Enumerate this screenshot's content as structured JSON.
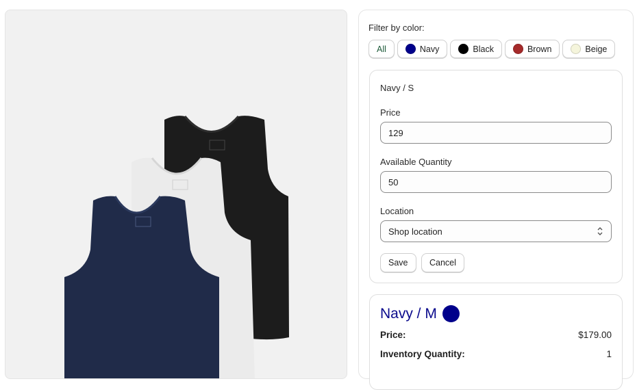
{
  "product_image": {
    "alt": "Tank tops in navy, white and black"
  },
  "filter": {
    "label": "Filter by color:",
    "chips": [
      {
        "label": "All",
        "color": null
      },
      {
        "label": "Navy",
        "color": "#00008B"
      },
      {
        "label": "Black",
        "color": "#000000"
      },
      {
        "label": "Brown",
        "color": "#A52A2A"
      },
      {
        "label": "Beige",
        "color": "#F5F5DC"
      }
    ]
  },
  "edit_form": {
    "title": "Navy / S",
    "price_label": "Price",
    "price_value": "129",
    "quantity_label": "Available Quantity",
    "quantity_value": "50",
    "location_label": "Location",
    "location_value": "Shop location",
    "save_label": "Save",
    "cancel_label": "Cancel"
  },
  "variant": {
    "title": "Navy / M",
    "color": "#00008B",
    "price_label": "Price:",
    "price_value": "$179.00",
    "inventory_label": "Inventory Quantity:",
    "inventory_value": "1"
  }
}
